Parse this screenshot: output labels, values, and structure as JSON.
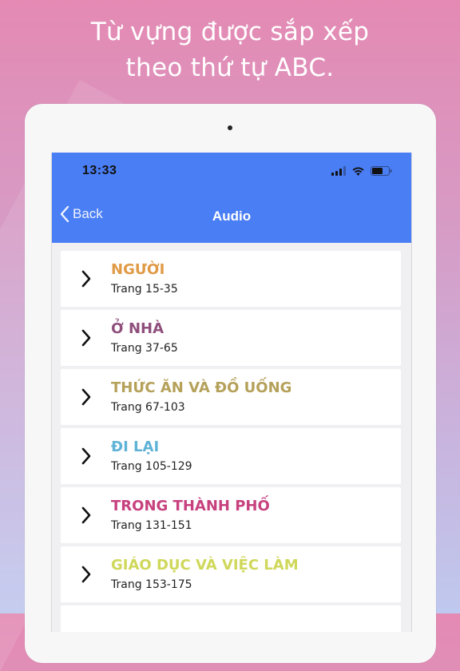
{
  "headline": {
    "line1": "Từ vựng được sắp xếp",
    "line2": "theo thứ tự ABC."
  },
  "status_bar": {
    "time": "13:33",
    "icons": [
      "cellular-signal-icon",
      "wifi-icon",
      "battery-icon"
    ]
  },
  "navbar": {
    "back_label": "Back",
    "title": "Audio",
    "color": "#4a7ef5"
  },
  "chapters": [
    {
      "title": "NGƯỜI",
      "pages": "Trang 15-35",
      "color": "#e09a45"
    },
    {
      "title": "Ở NHÀ",
      "pages": "Trang 37-65",
      "color": "#8f4f7c"
    },
    {
      "title": "THỨC ĂN VÀ ĐỒ UỐNG",
      "pages": "Trang 67-103",
      "color": "#b5a15a"
    },
    {
      "title": "ĐI LẠI",
      "pages": "Trang 105-129",
      "color": "#5fb3d6"
    },
    {
      "title": "TRONG THÀNH PHỐ",
      "pages": "Trang 131-151",
      "color": "#c7417e"
    },
    {
      "title": "GIÁO DỤC VÀ VIỆC LÀM",
      "pages": "Trang 153-175",
      "color": "#cfd85a"
    }
  ]
}
